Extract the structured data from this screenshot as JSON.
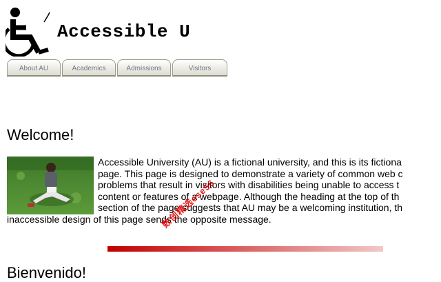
{
  "header": {
    "site_title": "Accessible U",
    "logo_icon": "wheelchair-accessibility-icon"
  },
  "nav": {
    "tabs": [
      {
        "label": "About AU"
      },
      {
        "label": "Academics"
      },
      {
        "label": "Admissions"
      },
      {
        "label": "Visitors"
      }
    ]
  },
  "main": {
    "welcome_heading": "Welcome!",
    "photo_description_icon": "student-reading-photo",
    "paragraph_lines": [
      "Accessible University (AU) is a fictional university, and this is its fictiona",
      "page. This page is designed to demonstrate a variety of common web c",
      "problems that result in visitors with disabilities being unable to access t",
      "content or features of a webpage. Although the heading at the top of th",
      "section of the page suggests that AU may be a welcoming institution, th",
      "inaccessible design of this page sends the opposite message."
    ],
    "spanish_heading": "Bienvenido!"
  },
  "watermark": {
    "text": "数创精选ese56"
  },
  "colors": {
    "tab_text": "#77778a",
    "divider_red": "#c00000"
  }
}
